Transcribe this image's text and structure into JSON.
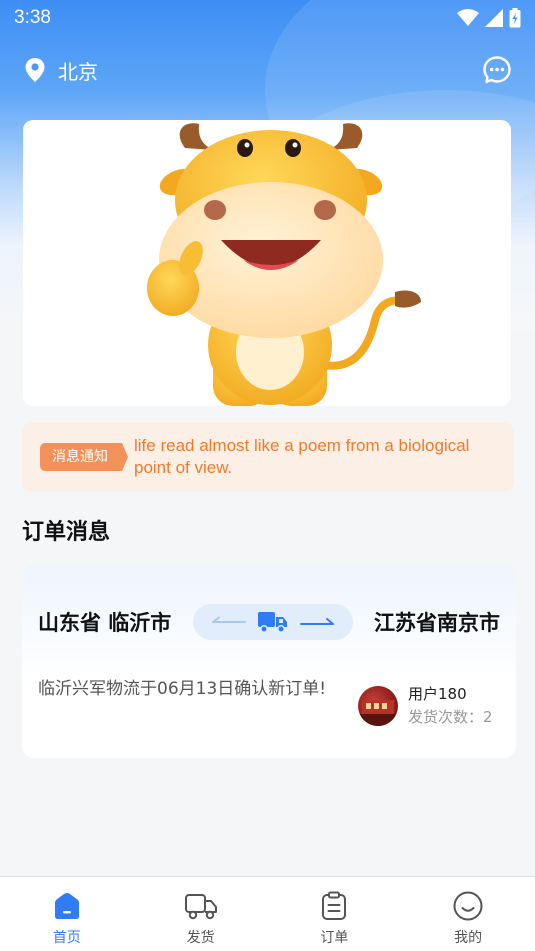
{
  "status_bar": {
    "time": "3:38"
  },
  "header": {
    "location": "北京"
  },
  "notice": {
    "tag": "消息通知",
    "text": "life read almost like a poem from a biological point of view."
  },
  "section": {
    "title": "订单消息"
  },
  "order": {
    "from": "山东省 临沂市",
    "to": "江苏省南京市",
    "description": "临沂兴军物流于06月13日确认新订单!",
    "user_name": "用户180",
    "ship_count_label": "发货次数：",
    "ship_count": "2"
  },
  "tabs": [
    {
      "label": "首页",
      "icon": "home-icon",
      "active": true
    },
    {
      "label": "发货",
      "icon": "truck-icon",
      "active": false
    },
    {
      "label": "订单",
      "icon": "clipboard-icon",
      "active": false
    },
    {
      "label": "我的",
      "icon": "smile-icon",
      "active": false
    }
  ],
  "colors": {
    "primary": "#2f7cf6",
    "notice_bg": "#fcefe5",
    "notice_accent": "#f2925a",
    "notice_text": "#ef7b2e"
  }
}
